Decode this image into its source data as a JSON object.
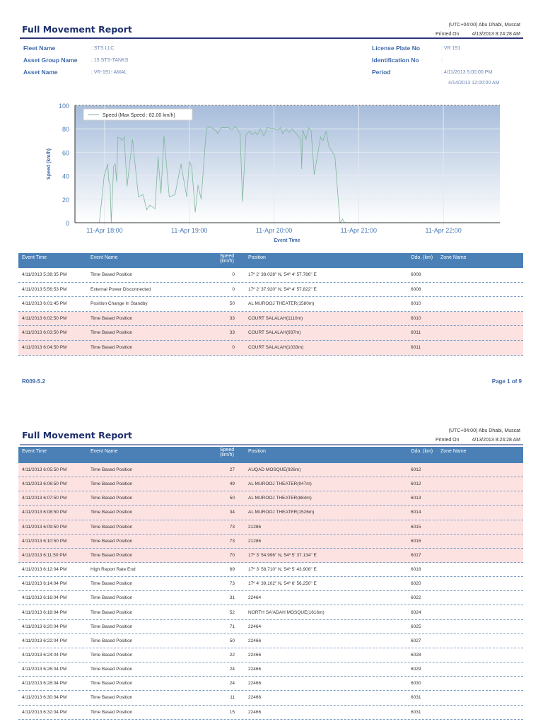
{
  "report_title": "Full Movement Report",
  "timezone": "(UTC+04:00) Abu Dhabi, Muscat",
  "printed_on_label": "Printed On",
  "printed_on": "4/13/2013 8:24:28 AM",
  "info": {
    "fleet_name_label": "Fleet Name",
    "fleet_name": ": STS LLC",
    "asset_group_label": "Asset Group Name",
    "asset_group": ": 15 STS-TANKS",
    "asset_name_label": "Asset Name",
    "asset_name": ": VR-191- AMAL",
    "license_label": "License Plate No",
    "license": ": VR 191",
    "ident_label": "Identification No",
    "ident": ":",
    "period_label": "Period",
    "period_start": ": 4/11/2013 5:00:00 PM",
    "period_end": "4/14/2013 12:00:00 AM"
  },
  "chart_data": {
    "type": "line",
    "title": "",
    "xlabel": "Event Time",
    "ylabel": "Speed (km/h)",
    "ylim": [
      0,
      100
    ],
    "yticks": [
      0,
      20,
      40,
      60,
      80,
      100
    ],
    "x_unit": "minutes after 11-Apr 17:00",
    "xlim": [
      39,
      340
    ],
    "xticks": [
      {
        "v": 60,
        "label": "11-Apr 18:00"
      },
      {
        "v": 120,
        "label": "11-Apr 19:00"
      },
      {
        "v": 180,
        "label": "11-Apr 20:00"
      },
      {
        "v": 240,
        "label": "11-Apr 21:00"
      },
      {
        "v": 300,
        "label": "11-Apr 22:00"
      }
    ],
    "legend": "Speed (Max Speed : 82.00 km/h)",
    "legend_position": "top-left",
    "grid": true,
    "series": [
      {
        "name": "Speed",
        "color": "#7fb79a",
        "x": [
          56.3,
          59.7,
          62.2,
          63.0,
          63.9,
          64.7,
          66.4,
          67.5,
          68.5,
          69.4,
          71.1,
          72.2,
          73.9,
          75.9,
          79.8,
          84.0,
          87.3,
          89.8,
          92.0,
          95.7,
          97.9,
          99.9,
          102.1,
          105.8,
          109.9,
          114.1,
          118.2,
          120.0,
          121.7,
          124.2,
          126.2,
          128.4,
          132.1,
          134.2,
          138.4,
          140.1,
          142.6,
          147.6,
          150.2,
          152.7,
          156.0,
          157.7,
          160.2,
          162.7,
          164.4,
          166.9,
          168.1,
          170.3,
          172.8,
          175.3,
          180.3,
          182.8,
          184.5,
          186.2,
          188.7,
          190.9,
          192.9,
          199.1,
          199.6,
          200.4,
          202.6,
          204.6,
          206.3,
          208.5,
          213.0,
          214.7,
          216.9,
          218.9,
          223.1,
          226.8,
          228.5,
          230.1
        ],
        "y": [
          0,
          40,
          50,
          35,
          33,
          0,
          48,
          50,
          35,
          73,
          72,
          70,
          73,
          31,
          71,
          22,
          24,
          11,
          15,
          12,
          56,
          25,
          74,
          22,
          24,
          50,
          22,
          52,
          48,
          9,
          32,
          20,
          80,
          82,
          79,
          76,
          81,
          81,
          79,
          82,
          76,
          18,
          75,
          78,
          75,
          77,
          75,
          80,
          74,
          81,
          80,
          79,
          81,
          76,
          80,
          77,
          80,
          71,
          46,
          79,
          71,
          81,
          78,
          41,
          73,
          70,
          78,
          65,
          57,
          0,
          3,
          0
        ]
      }
    ]
  },
  "table_headers": [
    "Event Time",
    "Event Name",
    "Speed (km/h)",
    "Position",
    "Odo. (km)",
    "Zone Name"
  ],
  "table_header_speed_line1": "Speed",
  "table_header_speed_line2": "(km/h)",
  "page1_rows": [
    {
      "time": "4/11/2013 5:38:35 PM",
      "event": "Time Based Position",
      "speed": "0",
      "position": "17º 2' 38.028\" N, 54º 4' 57.786\" E",
      "odo": "6008",
      "zone": "",
      "hl": false
    },
    {
      "time": "4/11/2013 5:56:53 PM",
      "event": "External Power Disconnected",
      "speed": "0",
      "position": "17º 2' 37.920\" N, 54º 4' 57.822\" E",
      "odo": "6008",
      "zone": "",
      "hl": false
    },
    {
      "time": "4/11/2013 6:01:45 PM",
      "event": "Position Change In Standby",
      "speed": "50",
      "position": "AL MUROOJ THEATER(1580m)",
      "odo": "6010",
      "zone": "",
      "hl": false
    },
    {
      "time": "4/11/2013 6:02:50 PM",
      "event": "Time Based Position",
      "speed": "33",
      "position": "COURT SALALAH(1110m)",
      "odo": "6010",
      "zone": "",
      "hl": true
    },
    {
      "time": "4/11/2013 6:03:50 PM",
      "event": "Time Based Position",
      "speed": "33",
      "position": "COURT SALALAH(937m)",
      "odo": "6011",
      "zone": "",
      "hl": true
    },
    {
      "time": "4/11/2013 6:04:50 PM",
      "event": "Time Based Position",
      "speed": "0",
      "position": "COURT SALALAH(1033m)",
      "odo": "6011",
      "zone": "",
      "hl": true
    }
  ],
  "page2_rows": [
    {
      "time": "4/11/2013 6:05:50 PM",
      "event": "Time Based Position",
      "speed": "27",
      "position": "AUQAD MOSQUE(926m)",
      "odo": "6012",
      "zone": "",
      "hl": true
    },
    {
      "time": "4/11/2013 6:06:50 PM",
      "event": "Time Based Position",
      "speed": "49",
      "position": "AL MUROOJ THEATER(947m)",
      "odo": "6012",
      "zone": "",
      "hl": true
    },
    {
      "time": "4/11/2013 6:07:50 PM",
      "event": "Time Based Position",
      "speed": "50",
      "position": "AL MUROOJ THEATER(884m)",
      "odo": "6013",
      "zone": "",
      "hl": true
    },
    {
      "time": "4/11/2013 6:08:50 PM",
      "event": "Time Based Position",
      "speed": "34",
      "position": "AL MUROOJ THEATER(1526m)",
      "odo": "6014",
      "zone": "",
      "hl": true
    },
    {
      "time": "4/11/2013 6:09:50 PM",
      "event": "Time Based Position",
      "speed": "73",
      "position": "21286",
      "odo": "6015",
      "zone": "",
      "hl": true
    },
    {
      "time": "4/11/2013 6:10:50 PM",
      "event": "Time Based Position",
      "speed": "73",
      "position": "21286",
      "odo": "6016",
      "zone": "",
      "hl": true
    },
    {
      "time": "4/11/2013 6:11:50 PM",
      "event": "Time Based Position",
      "speed": "70",
      "position": "17º 3' 54.996\" N, 54º 5' 37.134\" E",
      "odo": "6017",
      "zone": "",
      "hl": true
    },
    {
      "time": "4/11/2013 6:12:04 PM",
      "event": "High Report Rate End",
      "speed": "69",
      "position": "17º 3' 58.710\" N, 54º 5' 43.908\" E",
      "odo": "6018",
      "zone": "",
      "hl": false
    },
    {
      "time": "4/11/2013 6:14:04 PM",
      "event": "Time Based Position",
      "speed": "73",
      "position": "17º 4' 39.102\" N, 54º 6' 56.250\" E",
      "odo": "6020",
      "zone": "",
      "hl": false
    },
    {
      "time": "4/11/2013 6:16:04 PM",
      "event": "Time Based Position",
      "speed": "31",
      "position": "22464",
      "odo": "6022",
      "zone": "",
      "hl": false
    },
    {
      "time": "4/11/2013 6:18:04 PM",
      "event": "Time Based Position",
      "speed": "52",
      "position": "NORTH SA'ADAH MOSQUE(1616m)",
      "odo": "6024",
      "zone": "",
      "hl": false
    },
    {
      "time": "4/11/2013 6:20:04 PM",
      "event": "Time Based Position",
      "speed": "71",
      "position": "22464",
      "odo": "6025",
      "zone": "",
      "hl": false
    },
    {
      "time": "4/11/2013 6:22:04 PM",
      "event": "Time Based Position",
      "speed": "50",
      "position": "22466",
      "odo": "6027",
      "zone": "",
      "hl": false
    },
    {
      "time": "4/11/2013 6:24:04 PM",
      "event": "Time Based Position",
      "speed": "22",
      "position": "22466",
      "odo": "6028",
      "zone": "",
      "hl": false
    },
    {
      "time": "4/11/2013 6:26:04 PM",
      "event": "Time Based Position",
      "speed": "24",
      "position": "22466",
      "odo": "6029",
      "zone": "",
      "hl": false
    },
    {
      "time": "4/11/2013 6:28:04 PM",
      "event": "Time Based Position",
      "speed": "24",
      "position": "22466",
      "odo": "6030",
      "zone": "",
      "hl": false
    },
    {
      "time": "4/11/2013 6:30:04 PM",
      "event": "Time Based Position",
      "speed": "11",
      "position": "22466",
      "odo": "6031",
      "zone": "",
      "hl": false
    },
    {
      "time": "4/11/2013 6:32:04 PM",
      "event": "Time Based Position",
      "speed": "15",
      "position": "22466",
      "odo": "6031",
      "zone": "",
      "hl": false
    }
  ],
  "footer": {
    "code": "R009-5.2",
    "page": "Page 1 of 9"
  }
}
